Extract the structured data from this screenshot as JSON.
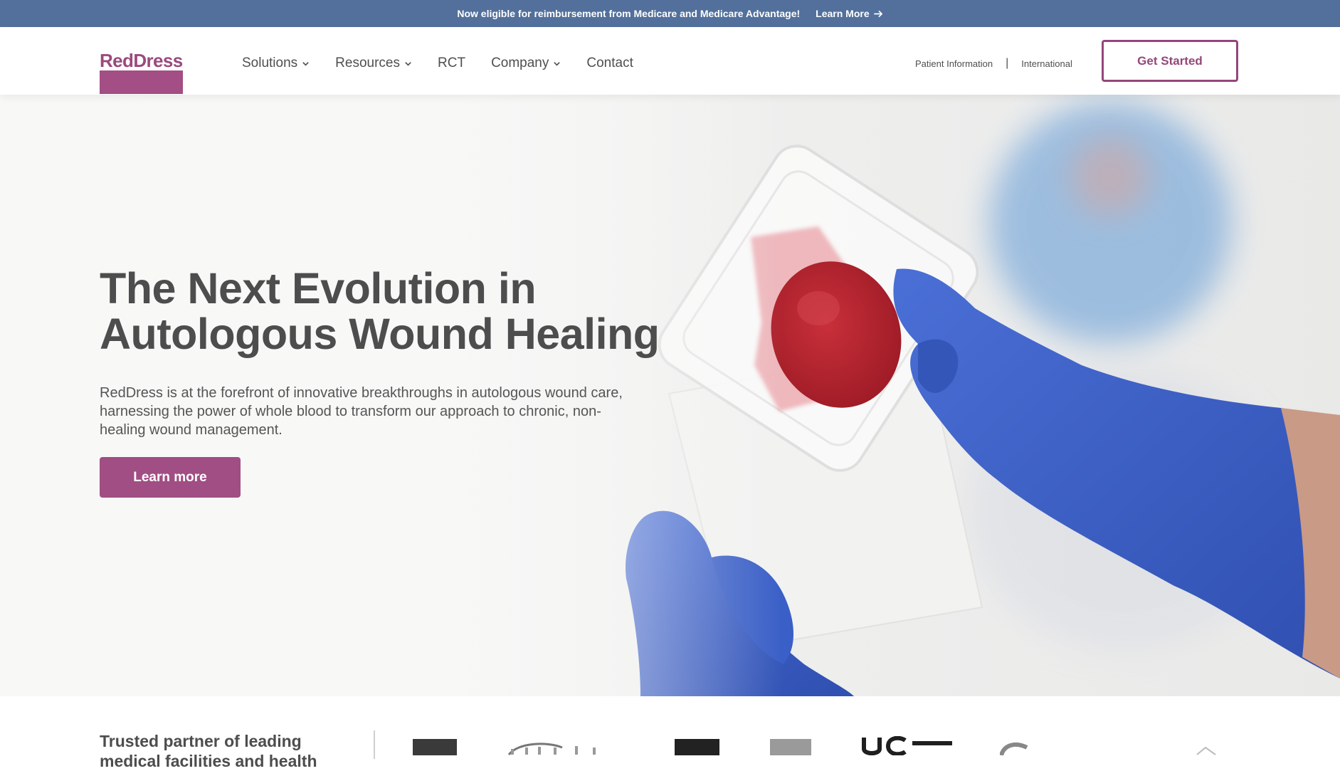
{
  "announcement": {
    "text": "Now eligible for reimbursement from Medicare and Medicare Advantage!",
    "link_label": "Learn More",
    "link_icon": "arrow-right-icon"
  },
  "header": {
    "logo_text": "RedDress",
    "nav": [
      {
        "label": "Solutions",
        "has_dropdown": true
      },
      {
        "label": "Resources",
        "has_dropdown": true
      },
      {
        "label": "RCT",
        "has_dropdown": false
      },
      {
        "label": "Company",
        "has_dropdown": true
      },
      {
        "label": "Contact",
        "has_dropdown": false
      }
    ],
    "utility_links": [
      "Patient Information",
      "International"
    ],
    "separator": "|",
    "cta_label": "Get Started"
  },
  "hero": {
    "title": "The Next Evolution in Autologous Wound Healing",
    "body": "RedDress is at the forefront of innovative breakthroughs in autologous wound care, harnessing the power of whole blood to transform our approach to chronic, non-healing wound management.",
    "button_label": "Learn more"
  },
  "trusted": {
    "title": "Trusted partner of leading medical facilities and health"
  },
  "colors": {
    "announce_bg": "#52709b",
    "brand": "#a04e83",
    "glove": "#3d5fc4",
    "clot": "#b8232e"
  }
}
